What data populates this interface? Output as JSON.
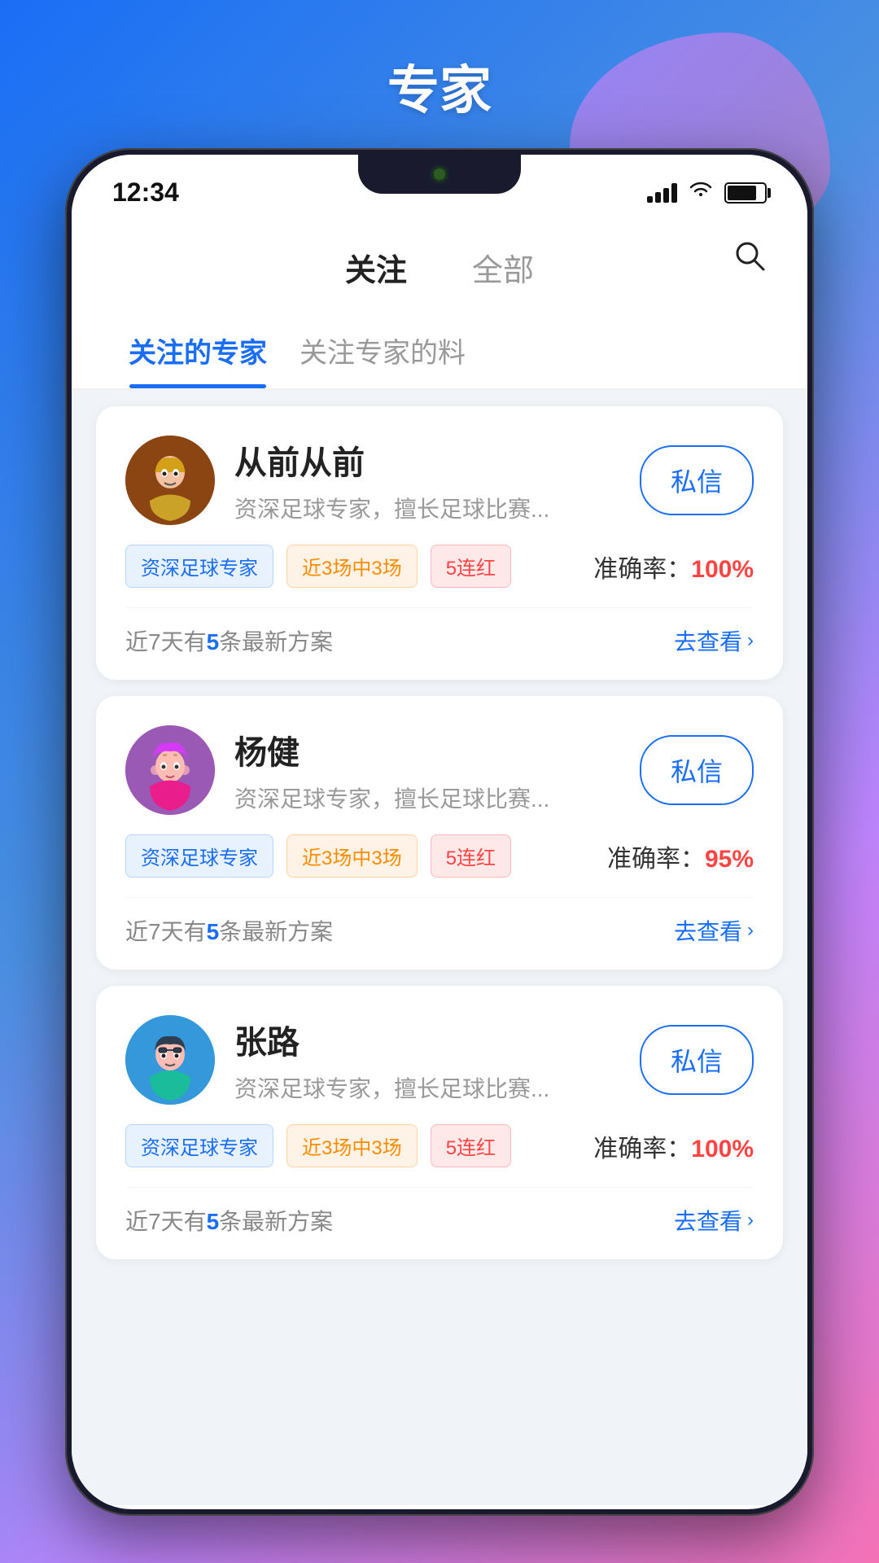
{
  "page": {
    "title": "专家",
    "background_colors": [
      "#1a6ef5",
      "#c084fc",
      "#f472b6"
    ]
  },
  "status_bar": {
    "time": "12:34",
    "signal": "signal",
    "wifi": "wifi",
    "battery": "battery"
  },
  "nav": {
    "tab_follow_label": "关注",
    "tab_all_label": "全部",
    "search_label": "搜索"
  },
  "sub_tabs": {
    "tab1_label": "关注的专家",
    "tab2_label": "关注专家的料"
  },
  "experts": [
    {
      "id": 1,
      "name": "从前从前",
      "desc": "资深足球专家，擅长足球比赛...",
      "tag1": "资深足球专家",
      "tag2": "近3场中3场",
      "tag3": "5连红",
      "accuracy_label": "准确率：",
      "accuracy_value": "100%",
      "recent_text_prefix": "近7天有",
      "recent_count": "5",
      "recent_text_suffix": "条最新方案",
      "view_label": "去查看",
      "msg_label": "私信",
      "avatar_type": "1"
    },
    {
      "id": 2,
      "name": "杨健",
      "desc": "资深足球专家，擅长足球比赛...",
      "tag1": "资深足球专家",
      "tag2": "近3场中3场",
      "tag3": "5连红",
      "accuracy_label": "准确率：",
      "accuracy_value": "95%",
      "recent_text_prefix": "近7天有",
      "recent_count": "5",
      "recent_text_suffix": "条最新方案",
      "view_label": "去查看",
      "msg_label": "私信",
      "avatar_type": "2"
    },
    {
      "id": 3,
      "name": "张路",
      "desc": "资深足球专家，擅长足球比赛...",
      "tag1": "资深足球专家",
      "tag2": "近3场中3场",
      "tag3": "5连红",
      "accuracy_label": "准确率：",
      "accuracy_value": "100%",
      "recent_text_prefix": "近7天有",
      "recent_count": "5",
      "recent_text_suffix": "条最新方案",
      "view_label": "去查看",
      "msg_label": "私信",
      "avatar_type": "3"
    }
  ]
}
